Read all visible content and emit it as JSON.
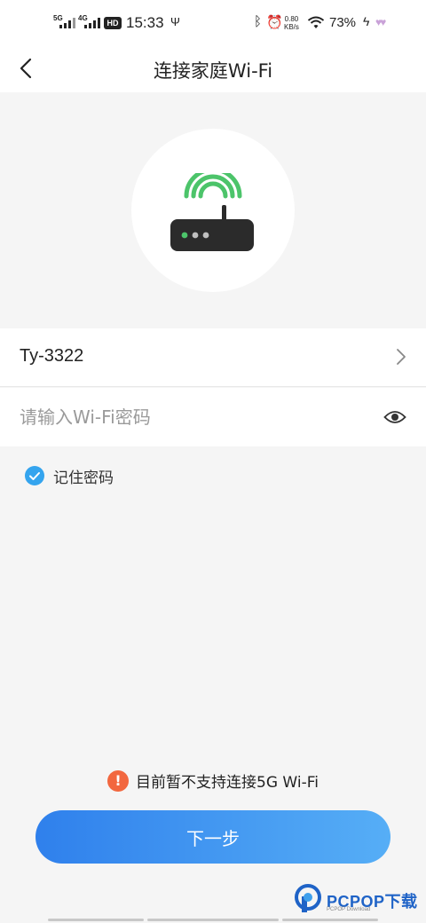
{
  "status_bar": {
    "net1": "5G",
    "net2": "4G",
    "hd": "HD",
    "time": "15:33",
    "speed_value": "0.80",
    "speed_unit": "KB/s",
    "battery": "73%"
  },
  "nav": {
    "title": "连接家庭Wi-Fi",
    "back_icon": "chevron-left-icon"
  },
  "hero": {
    "icon": "router-wifi-icon",
    "wifi_color": "#4cc46a",
    "router_color": "#2b2b2b"
  },
  "ssid": {
    "name": "Ty-3322",
    "icon": "chevron-right-icon"
  },
  "password": {
    "value": "",
    "placeholder": "请输入Wi-Fi密码",
    "icon": "eye-icon"
  },
  "remember": {
    "label": "记住密码",
    "checked": true,
    "color": "#34a4ee"
  },
  "notice": {
    "icon": "warning-icon",
    "text": "目前暂不支持连接5G Wi-Fi",
    "color": "#f2673f"
  },
  "next_button": {
    "label": "下一步",
    "gradient": [
      "#2f80ec",
      "#56aef6"
    ]
  },
  "watermark": {
    "brand": "PCPOP下载",
    "sub": "PCPOP Download"
  }
}
